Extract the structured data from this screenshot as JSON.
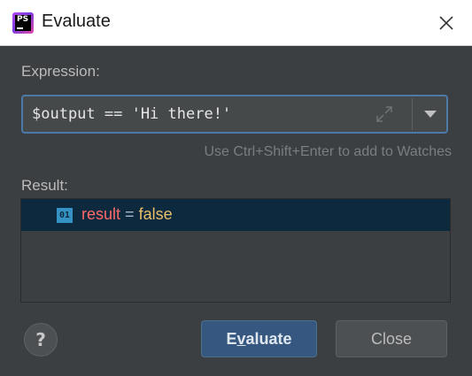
{
  "window": {
    "title": "Evaluate",
    "app_icon_text": "PS",
    "close_icon": "close-icon"
  },
  "expression": {
    "label": "Expression:",
    "value": "$output == 'Hi there!'",
    "expand_icon": "expand-icon",
    "dropdown_icon": "chevron-down-icon",
    "hint": "Use Ctrl+Shift+Enter to add to Watches"
  },
  "result": {
    "label": "Result:",
    "rows": [
      {
        "type_icon_text": "01",
        "name": "result",
        "operator": "=",
        "value": "false"
      }
    ]
  },
  "buttons": {
    "help": "?",
    "evaluate_prefix": "E",
    "evaluate_mnemonic": "v",
    "evaluate_suffix": "aluate",
    "close": "Close"
  },
  "colors": {
    "background": "#3c3f41",
    "accent": "#365880",
    "focus_border": "#4b7aa8",
    "selected_row": "#0d293e",
    "variable_name": "#ff6b68",
    "boolean_value": "#e8bf6a"
  }
}
